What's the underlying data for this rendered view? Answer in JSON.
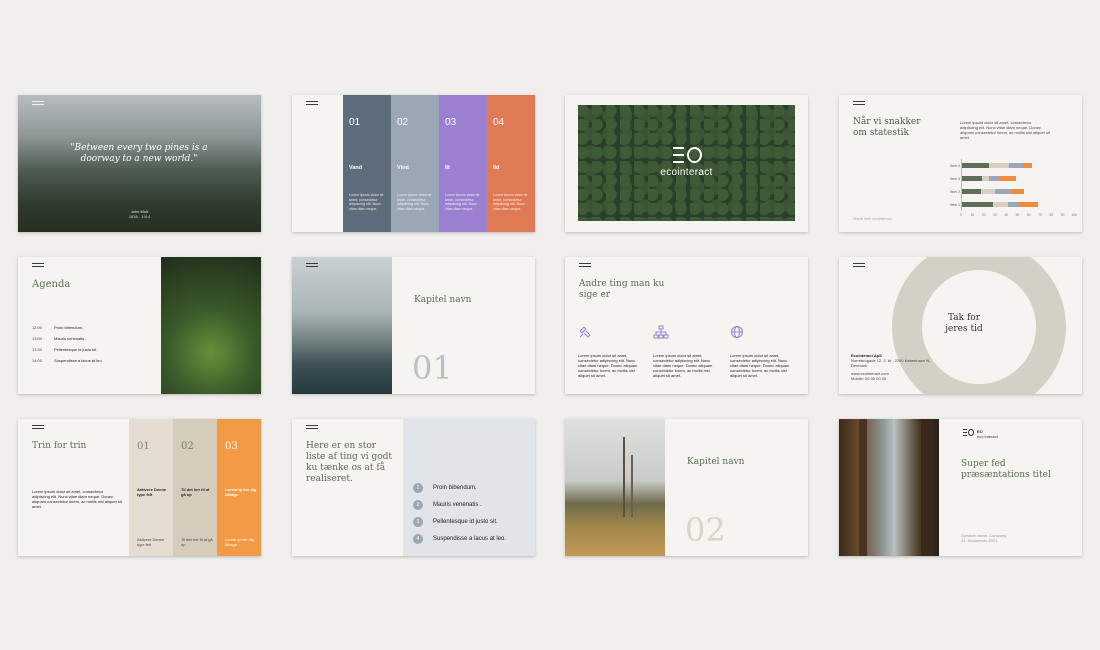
{
  "slides": {
    "s1": {
      "quote": "\"Between every two pines is a doorway to a new world.\"",
      "author": "John Muir",
      "author_sub": "1838 - 1914"
    },
    "s2": {
      "cols": [
        {
          "num": "01",
          "label": "Vand",
          "text": "Lorem ipsum dolor sit amet, consectetur adipiscing elit. Nunc vitae diam neque."
        },
        {
          "num": "02",
          "label": "Vind",
          "text": "Lorem ipsum dolor sit amet, consectetur adipiscing elit. Nunc vitae diam neque."
        },
        {
          "num": "03",
          "label": "Ilt",
          "text": "Lorem ipsum dolor sit amet, consectetur adipiscing elit. Nunc vitae diam neque."
        },
        {
          "num": "04",
          "label": "Ild",
          "text": "Lorem ipsum dolor sit amet, consectetur adipiscing elit. Nunc vitae diam neque."
        }
      ]
    },
    "s3": {
      "logo_text": "ecointeract"
    },
    "s4": {
      "title": "Når vi snakker om statestik",
      "text": "Lorem ipsum dolor sit amet, consectetur adipiscing elit. Nunc vitae diam neque. Donec aliquam consectetur lorem, ac mollis nisi aliquet sit amet.",
      "footer": "Made with ecointeract",
      "chart_data": {
        "type": "bar",
        "orientation": "horizontal",
        "stacked": true,
        "categories": [
          "Item 4",
          "Item 3",
          "Item 2",
          "Item 1"
        ],
        "series": [
          {
            "values": [
              24,
              18,
              17,
              27
            ],
            "color": "#5f6e5a"
          },
          {
            "values": [
              18,
              6,
              12,
              14
            ],
            "color": "#d9cfc1"
          },
          {
            "values": [
              12,
              10,
              14,
              10
            ],
            "color": "#9aa7b8"
          },
          {
            "values": [
              8,
              14,
              12,
              16
            ],
            "color": "#f08b3a"
          }
        ],
        "xticks": [
          "0",
          "10",
          "20",
          "30",
          "40",
          "50",
          "60",
          "70",
          "80",
          "90",
          "100"
        ],
        "xlim": [
          0,
          100
        ]
      }
    },
    "s5": {
      "title": "Agenda",
      "items": [
        {
          "time": "12:00",
          "text": "Proin bibendum."
        },
        {
          "time": "13:00",
          "text": "Mauris venenatis ."
        },
        {
          "time": "13:30",
          "text": "Pellentesque id justo sit."
        },
        {
          "time": "14:00",
          "text": "Suspendisse a lacus at leo"
        }
      ]
    },
    "s6": {
      "title": "Kapitel navn",
      "num": "01"
    },
    "s7": {
      "title": "Andre ting man ku sige er",
      "cols": [
        {
          "text": "Lorem ipsum dolor sit amet, consectetur adipiscing elit. Nunc vitae diam neque. Donec aliquam consectetur lorem, ac mollis nisi aliquet sit amet."
        },
        {
          "text": "Lorem ipsum dolor sit amet, consectetur adipiscing elit. Nunc vitae diam neque. Donec aliquam consectetur lorem, ac mollis nisi aliquet sit amet."
        },
        {
          "text": "Lorem ipsum dolor sit amet, consectetur adipiscing elit. Nunc vitae diam neque. Donec aliquam consectetur lorem, ac mollis nisi aliquet sit amet."
        }
      ]
    },
    "s8": {
      "title": "Tak for jeres tid",
      "contact_name": "Ecointeract ApS",
      "contact_lines": "Norrebrogade 12, 2. th., 2200 København N, Denmark",
      "contact_web": "www.ecointeract.com",
      "contact_phone": "Mobile: 00 00 00 00"
    },
    "s9": {
      "title": "Trin for trin",
      "text": "Lorem ipsum dolor sit amet, consectetur adipiscing elit. Nunc vitae diam neque. Donec aliquam consectetur lorem, ac mollis nisi aliquet sit amet.",
      "cols": [
        {
          "num": "01",
          "label": "Aktivere Denne type felt",
          "sub": "Aktivere Denne type felt"
        },
        {
          "num": "02",
          "label": "Til det her til at gå op",
          "sub": "Til det her til at gå op"
        },
        {
          "num": "03",
          "label": "Lorem ip her dig tilbage",
          "sub": "Lorem ip her dig tilbage"
        }
      ]
    },
    "s10": {
      "title": "Here er en stor liste af ting vi godt ku tænke os at få realiseret.",
      "items": [
        {
          "num": "1",
          "text": "Proin bibendum."
        },
        {
          "num": "2",
          "text": "Mauris venenatis ."
        },
        {
          "num": "3",
          "text": "Pellentesque id justo sit."
        },
        {
          "num": "4",
          "text": "Suspendisse a lacus at leo."
        }
      ]
    },
    "s11": {
      "title": "Kapitel navn",
      "num": "02"
    },
    "s12": {
      "logo_line1": "EO",
      "logo_line2": "eco interact",
      "title": "Super fed præsæntations titel",
      "sub": "Speaker name, Company 24. September 2021"
    }
  },
  "colors": {
    "page_bg": "#f0efed",
    "slate": "#5e6d7c",
    "steel": "#9aa7b4",
    "purple": "#9b7fd1",
    "coral": "#e07a55",
    "orange": "#f39a46",
    "sand": "#ddd4c8",
    "beige": "#cfc8b8",
    "sage": "#6e7f67",
    "bluegray": "#e1e4e8"
  }
}
